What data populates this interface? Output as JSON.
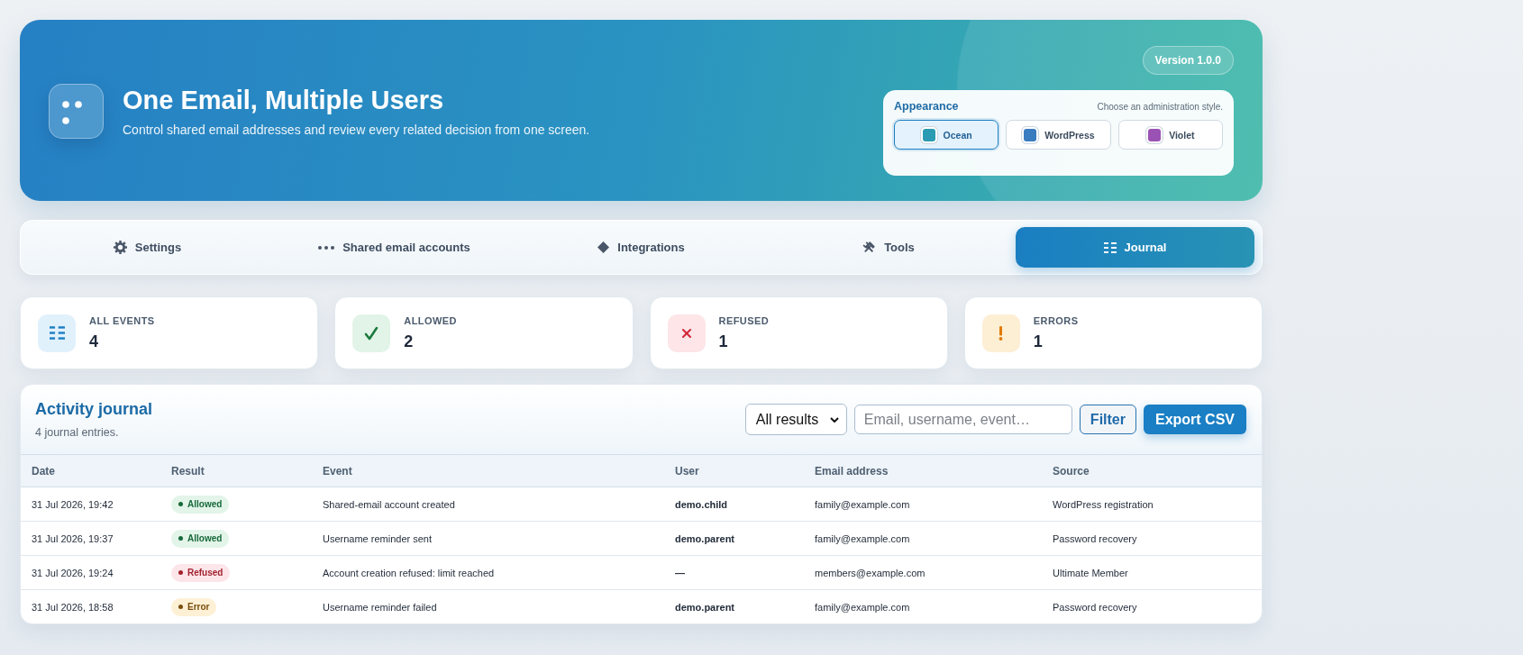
{
  "header": {
    "title": "One Email, Multiple Users",
    "subtitle": "Control shared email addresses and review every related decision from one screen.",
    "version": "Version 1.0.0"
  },
  "appearance": {
    "title": "Appearance",
    "hint": "Choose an administration style.",
    "themes": [
      {
        "label": "Ocean",
        "color": "#2b9bb3",
        "selected": true
      },
      {
        "label": "WordPress",
        "color": "#3a7cc0",
        "selected": false
      },
      {
        "label": "Violet",
        "color": "#9b52b5",
        "selected": false
      }
    ]
  },
  "tabs": [
    {
      "label": "Settings",
      "selected": false
    },
    {
      "label": "Shared email accounts",
      "selected": false
    },
    {
      "label": "Integrations",
      "selected": false
    },
    {
      "label": "Tools",
      "selected": false
    },
    {
      "label": "Journal",
      "selected": true
    }
  ],
  "stats": [
    {
      "kind": "total",
      "label": "ALL EVENTS",
      "value": "4"
    },
    {
      "kind": "allowed",
      "label": "ALLOWED",
      "value": "2"
    },
    {
      "kind": "refused",
      "label": "REFUSED",
      "value": "1"
    },
    {
      "kind": "error",
      "label": "ERRORS",
      "value": "1"
    }
  ],
  "journal": {
    "title": "Activity journal",
    "subtitle": "4 journal entries.",
    "result_filter": "All results",
    "search": {
      "placeholder": "Email, username, event…"
    },
    "buttons": [
      {
        "label": "Filter",
        "kind": "secondary"
      },
      {
        "label": "Export CSV",
        "kind": "primary"
      }
    ],
    "table": {
      "columns": [
        "Date",
        "Result",
        "Event",
        "User",
        "Email address",
        "Source"
      ],
      "rows": [
        {
          "date": "31 Jul 2026, 19:42",
          "result": {
            "label": "Allowed",
            "kind": "allowed"
          },
          "event": "Shared-email account created",
          "user": "demo.child",
          "email": "family@example.com",
          "source": "WordPress registration"
        },
        {
          "date": "31 Jul 2026, 19:37",
          "result": {
            "label": "Allowed",
            "kind": "allowed"
          },
          "event": "Username reminder sent",
          "user": "demo.parent",
          "email": "family@example.com",
          "source": "Password recovery"
        },
        {
          "date": "31 Jul 2026, 19:24",
          "result": {
            "label": "Refused",
            "kind": "refused"
          },
          "event": "Account creation refused: limit reached",
          "user": "—",
          "email": "members@example.com",
          "source": "Ultimate Member"
        },
        {
          "date": "31 Jul 2026, 18:58",
          "result": {
            "label": "Error",
            "kind": "error"
          },
          "event": "Username reminder failed",
          "user": "demo.parent",
          "email": "family@example.com",
          "source": "Password recovery"
        }
      ]
    }
  }
}
